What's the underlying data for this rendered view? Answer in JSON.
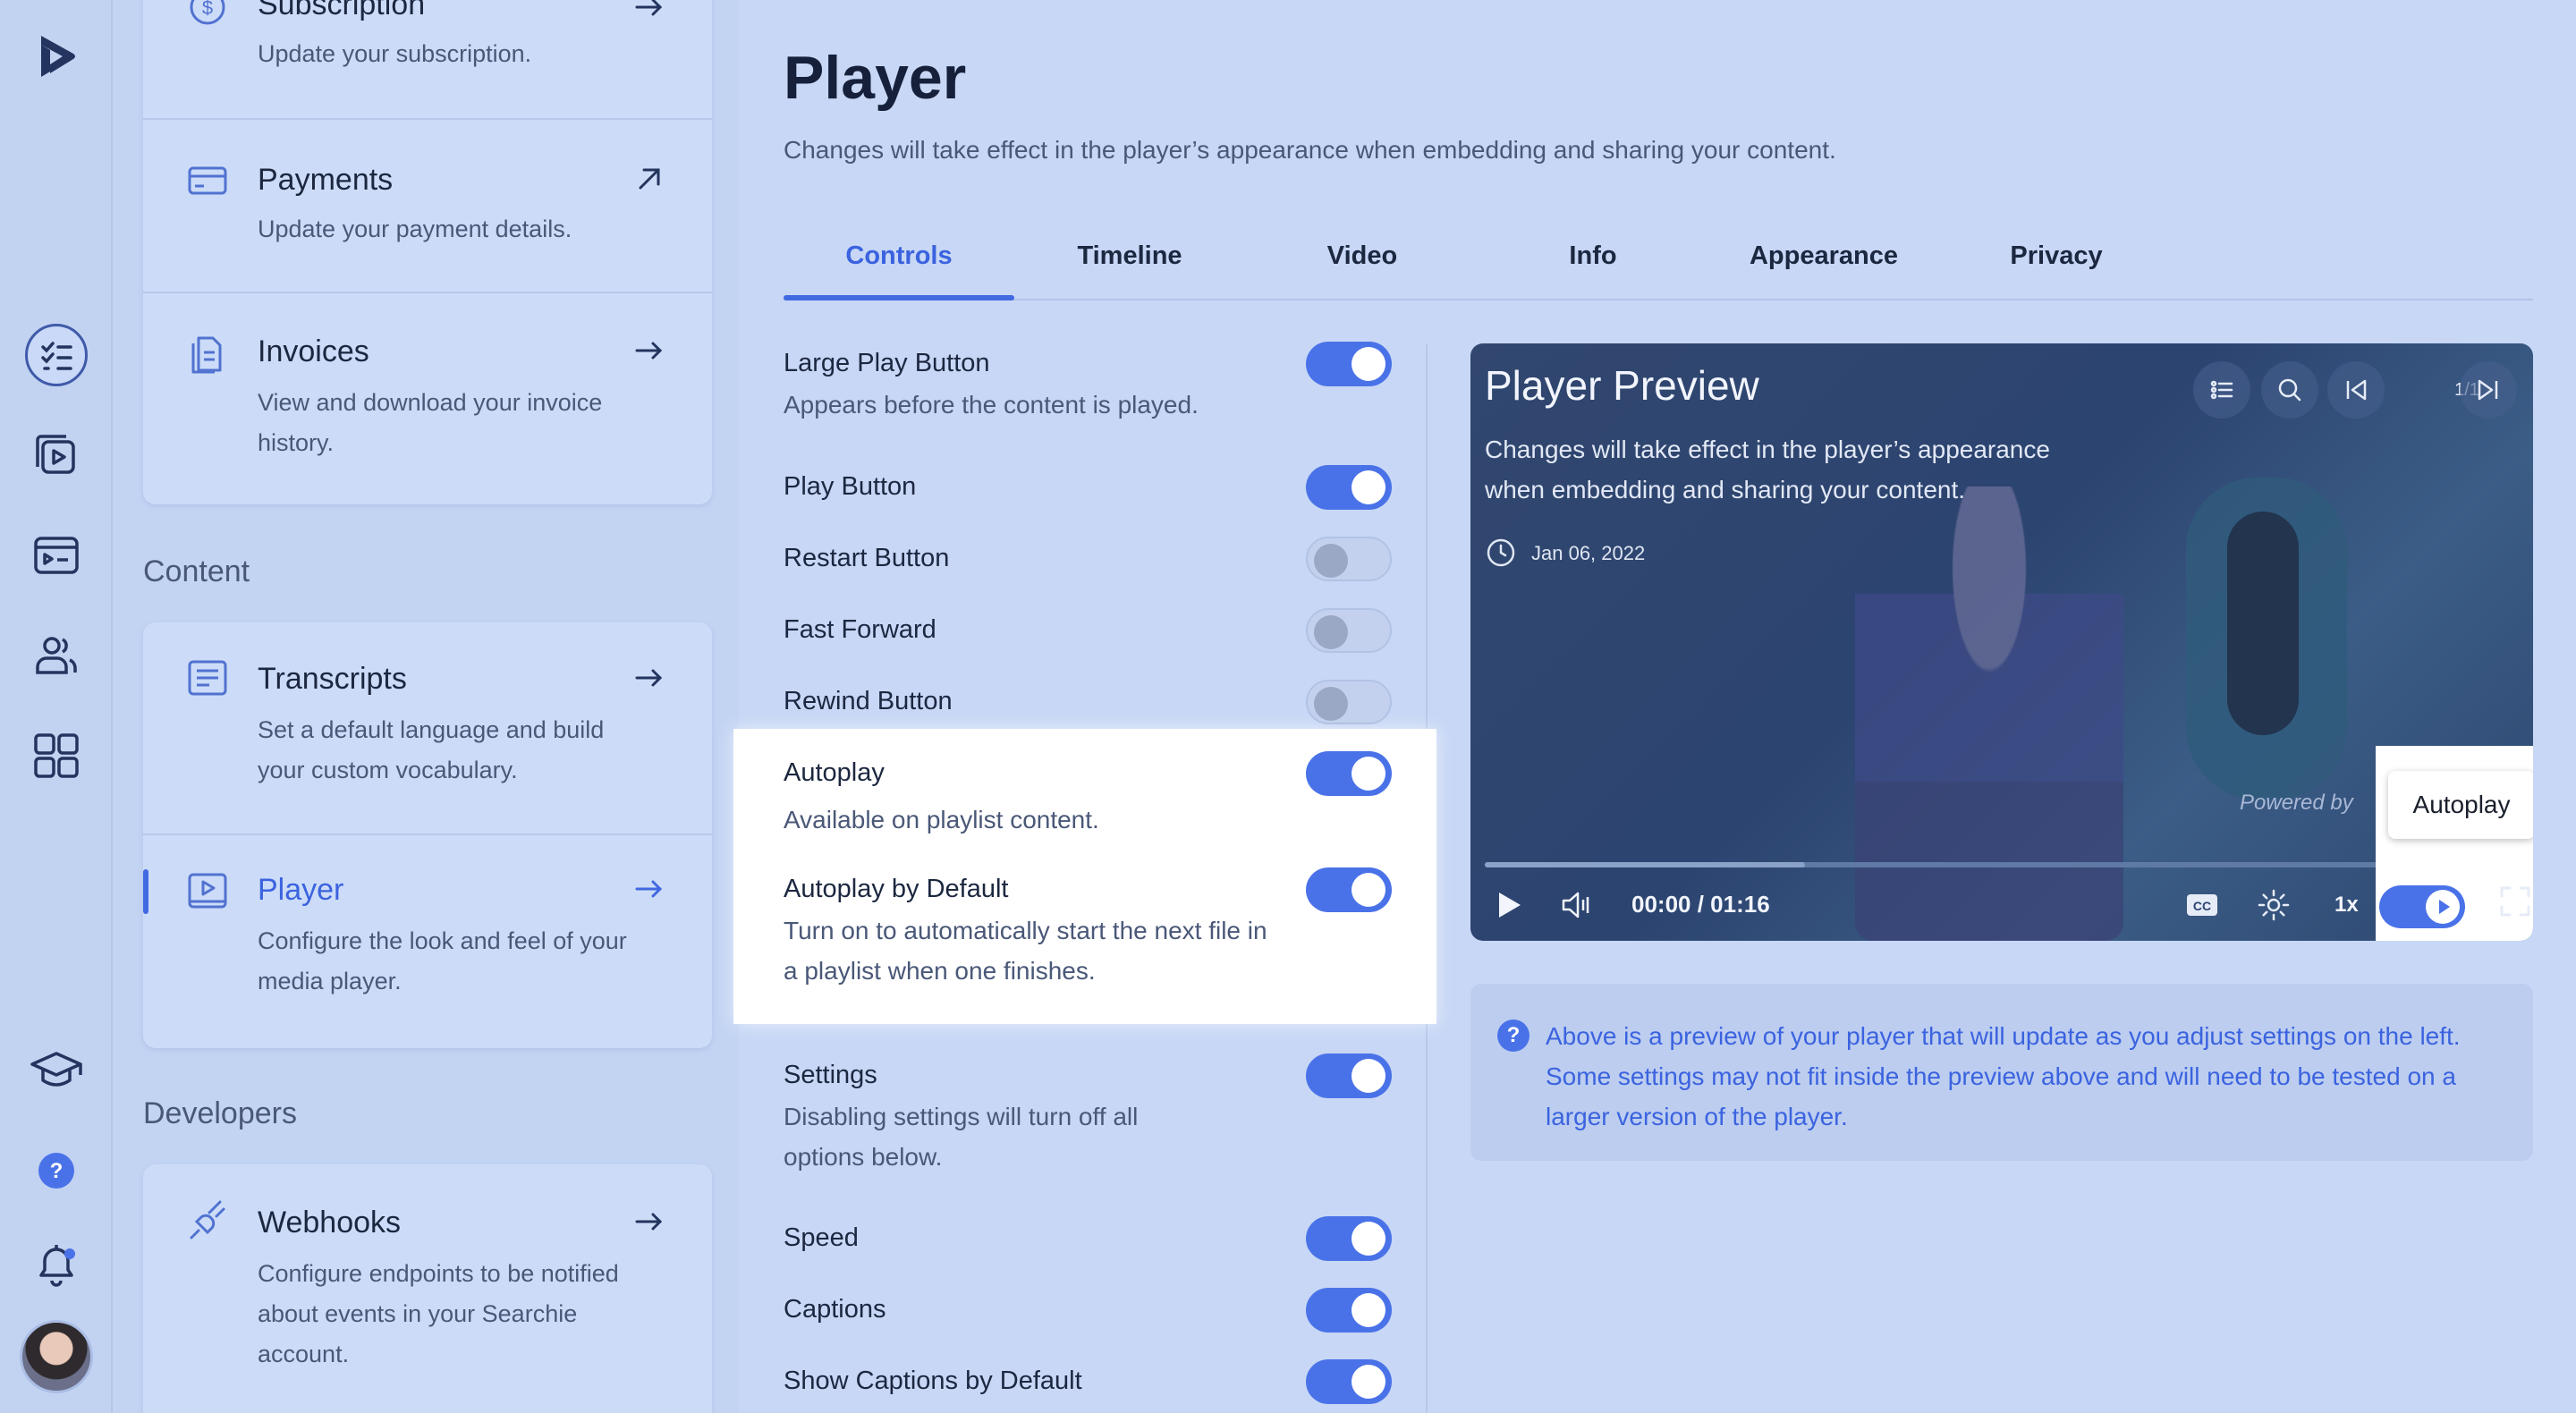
{
  "rail": {
    "icons": [
      "logo-icon",
      "checklist-icon",
      "video-library-icon",
      "playlist-icon",
      "users-icon",
      "apps-grid-icon",
      "graduation-cap-icon",
      "help-icon",
      "bell-icon"
    ]
  },
  "nav": {
    "items": [
      {
        "title": "Subscription",
        "desc": "Update your subscription."
      },
      {
        "title": "Payments",
        "desc": "Update your payment details."
      },
      {
        "title": "Invoices",
        "desc": "View and download your invoice history."
      },
      {
        "title": "Transcripts",
        "desc": "Set a default language and build your custom vocabulary."
      },
      {
        "title": "Player",
        "desc": "Configure the look and feel of your media player."
      },
      {
        "title": "Webhooks",
        "desc": "Configure endpoints to be notified about events in your Searchie account."
      }
    ],
    "sections": {
      "content": "Content",
      "developers": "Developers"
    }
  },
  "main": {
    "title": "Player",
    "subtitle": "Changes will take effect in the player’s appearance when embedding and sharing your content.",
    "tabs": [
      "Controls",
      "Timeline",
      "Video",
      "Info",
      "Appearance",
      "Privacy"
    ],
    "active_tab": "Controls"
  },
  "settings": [
    {
      "label": "Large Play Button",
      "desc": "Appears before the content is played.",
      "on": true
    },
    {
      "label": "Play Button",
      "desc": "",
      "on": true
    },
    {
      "label": "Restart Button",
      "desc": "",
      "on": false
    },
    {
      "label": "Fast Forward",
      "desc": "",
      "on": false
    },
    {
      "label": "Rewind Button",
      "desc": "",
      "on": false
    },
    {
      "label": "Autoplay",
      "desc": "Available on playlist content.",
      "on": true
    },
    {
      "label": "Autoplay by Default",
      "desc": "Turn on to automatically start the next file in a playlist when one finishes.",
      "on": true
    },
    {
      "label": "Settings",
      "desc": "Disabling settings will turn off all options below.",
      "on": true
    },
    {
      "label": "Speed",
      "desc": "",
      "on": true
    },
    {
      "label": "Captions",
      "desc": "",
      "on": true
    },
    {
      "label": "Show Captions by Default",
      "desc": "",
      "on": true
    }
  ],
  "preview": {
    "title": "Player Preview",
    "desc": "Changes will take effect in the player’s appearance when embedding and sharing your content.",
    "date": "Jan 06, 2022",
    "page": "1/1",
    "powered": "Powered by",
    "time": "00:00 / 01:16",
    "speed": "1x",
    "tooltip": "Autoplay",
    "progress": 0.31,
    "autoplay_on": true
  },
  "info": {
    "text": "Above is a preview of your player that will update as you adjust settings on the left. Some settings may not fit inside the preview above and will need to be tested on a larger version of the player."
  },
  "colors": {
    "accent": "#4169e1",
    "background": "#c7d7f5",
    "toggle_on": "#4a72e8"
  }
}
